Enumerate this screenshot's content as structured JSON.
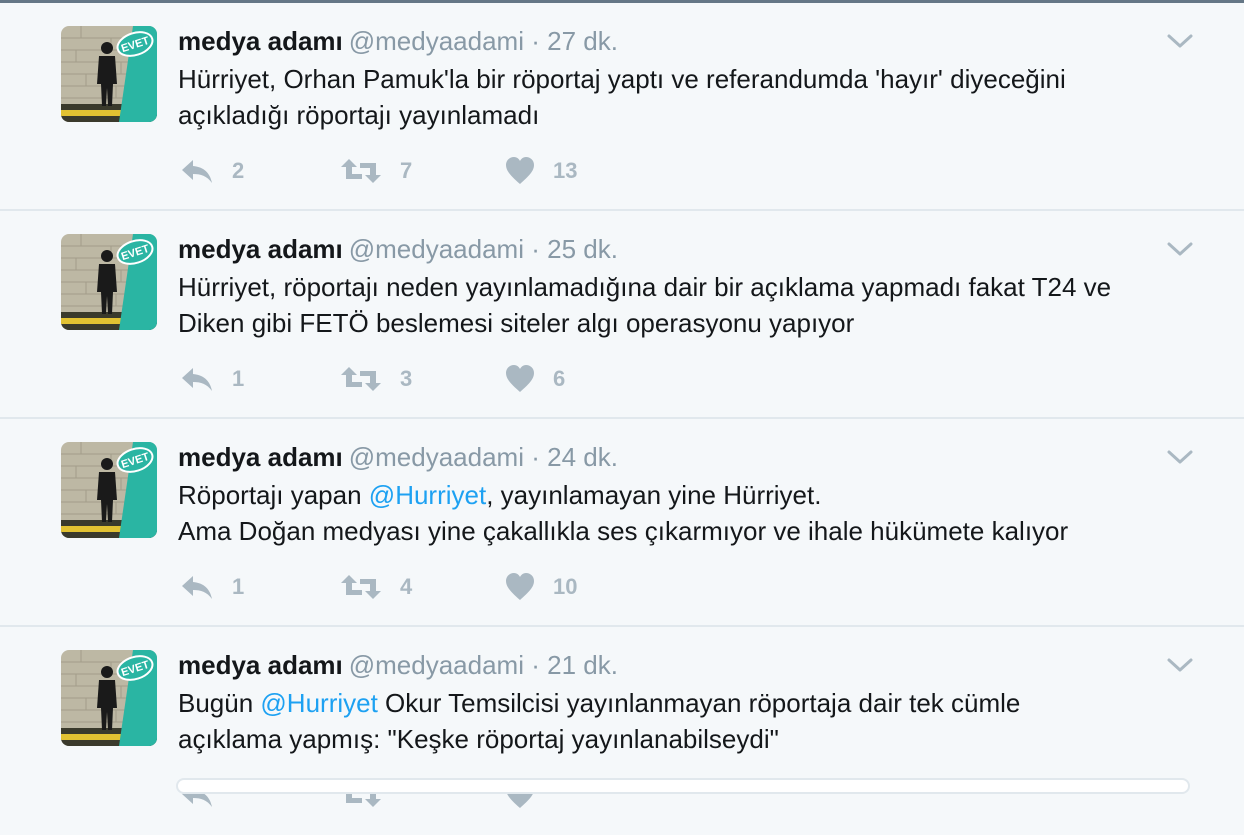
{
  "tweets": [
    {
      "name": "medya adamı",
      "handle": "@medyaadami",
      "separator": "·",
      "time": "27 dk.",
      "lines": [
        [
          {
            "t": "Hürriyet, Orhan Pamuk'la bir röportaj yaptı ve referandumda 'hayır' diyeceğini"
          }
        ],
        [
          {
            "t": "açıkladığı röportajı yayınlamadı"
          }
        ]
      ],
      "replies": "2",
      "retweets": "7",
      "likes": "13"
    },
    {
      "name": "medya adamı",
      "handle": "@medyaadami",
      "separator": "·",
      "time": "25 dk.",
      "lines": [
        [
          {
            "t": "Hürriyet, röportajı neden yayınlamadığına dair bir açıklama yapmadı fakat T24 ve"
          }
        ],
        [
          {
            "t": "Diken gibi FETÖ beslemesi siteler algı operasyonu yapıyor"
          }
        ]
      ],
      "replies": "1",
      "retweets": "3",
      "likes": "6"
    },
    {
      "name": "medya adamı",
      "handle": "@medyaadami",
      "separator": "·",
      "time": "24 dk.",
      "lines": [
        [
          {
            "t": "Röportajı yapan "
          },
          {
            "t": "@Hurriyet",
            "m": true
          },
          {
            "t": ", yayınlamayan yine Hürriyet."
          }
        ],
        [
          {
            "t": "Ama Doğan medyası yine çakallıkla ses çıkarmıyor ve ihale hükümete kalıyor"
          }
        ]
      ],
      "replies": "1",
      "retweets": "4",
      "likes": "10"
    },
    {
      "name": "medya adamı",
      "handle": "@medyaadami",
      "separator": "·",
      "time": "21 dk.",
      "lines": [
        [
          {
            "t": "Bugün "
          },
          {
            "t": "@Hurriyet",
            "m": true
          },
          {
            "t": " Okur Temsilcisi yayınlanmayan röportaja dair tek cümle"
          }
        ],
        [
          {
            "t": "açıklama yapmış: \"Keşke röportaj yayınlanabilseydi\""
          }
        ]
      ],
      "replies": "",
      "retweets": "",
      "likes": ""
    }
  ],
  "avatar_badge": "EVET",
  "colors": {
    "background": "#f5f8fa",
    "divider": "#e1e8ed",
    "text": "#14171a",
    "muted": "#8899a6",
    "action_gray": "#aab8c2",
    "mention": "#1da1f2",
    "avatar_teal": "#2ab5a3"
  },
  "icons": [
    "reply-icon",
    "retweet-icon",
    "heart-icon",
    "chevron-down-icon"
  ]
}
